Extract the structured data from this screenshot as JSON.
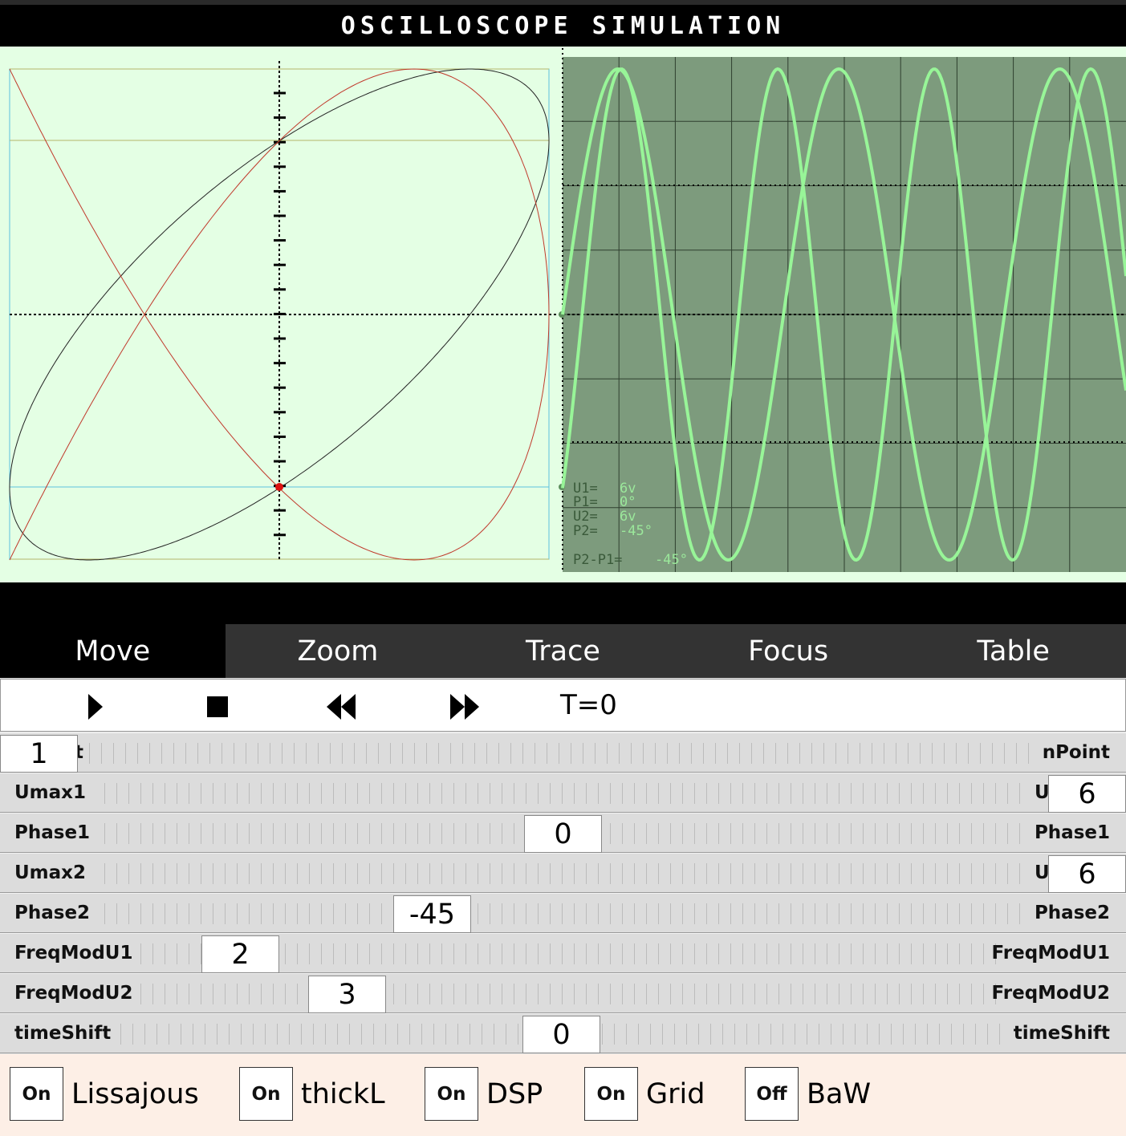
{
  "title": "OSCILLOSCOPE SIMULATION",
  "readout": {
    "u1_label": "U1=",
    "u1_value": "6v",
    "p1_label": "P1=",
    "p1_value": "0°",
    "u2_label": "U2=",
    "u2_value": "6v",
    "p2_label": "P2=",
    "p2_value": "-45°",
    "diff_label": "P2-P1=",
    "diff_value": "-45°"
  },
  "tabs": [
    {
      "label": "Move",
      "active": true
    },
    {
      "label": "Zoom",
      "active": false
    },
    {
      "label": "Trace",
      "active": false
    },
    {
      "label": "Focus",
      "active": false
    },
    {
      "label": "Table",
      "active": false
    }
  ],
  "player": {
    "play_icon": "play-icon",
    "stop_icon": "stop-icon",
    "rewind_icon": "rewind-icon",
    "forward_icon": "fast-forward-icon",
    "time": "T=0"
  },
  "sliders": {
    "npoint": {
      "clip_label": "t",
      "right_label": "nPoint",
      "value": "1"
    },
    "umax1": {
      "left_label": "Umax1",
      "right_clip": "U",
      "value": "6"
    },
    "phase1": {
      "left_label": "Phase1",
      "right_label": "Phase1",
      "value": "0"
    },
    "umax2": {
      "left_label": "Umax2",
      "right_clip": "U",
      "value": "6"
    },
    "phase2": {
      "left_label": "Phase2",
      "right_label": "Phase2",
      "value": "-45"
    },
    "freqmodu1": {
      "left_label": "FreqModU1",
      "right_label": "FreqModU1",
      "value": "2"
    },
    "freqmodu2": {
      "left_label": "FreqModU2",
      "right_label": "FreqModU2",
      "value": "3"
    },
    "timeshift": {
      "left_label": "timeShift",
      "right_label": "timeShift",
      "value": "0"
    }
  },
  "toggles": [
    {
      "state": "On",
      "label": "Lissajous"
    },
    {
      "state": "On",
      "label": "thickL"
    },
    {
      "state": "On",
      "label": "DSP"
    },
    {
      "state": "On",
      "label": "Grid"
    },
    {
      "state": "Off",
      "label": "BaW"
    }
  ],
  "colors": {
    "screen_bg": "#7d9b7d",
    "trace": "#98f598",
    "lissajous_red": "#c0392b",
    "lissajous_black": "#222222",
    "panel_bg": "#e4ffe4"
  }
}
